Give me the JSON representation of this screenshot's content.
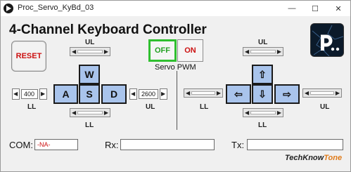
{
  "window": {
    "title": "Proc_Servo_KyBd_03",
    "minimize_glyph": "—",
    "maximize_glyph": "☐",
    "close_glyph": "✕"
  },
  "main": {
    "title": "4-Channel Keyboard Controller",
    "reset_label": "RESET",
    "logo_icon": "processing-logo-icon"
  },
  "left_pad": {
    "keys": {
      "up": "W",
      "left": "A",
      "center": "S",
      "right": "D"
    },
    "labels": {
      "top": "UL",
      "bottom": "LL",
      "left": "LL",
      "right": "UL"
    },
    "left_value": "400",
    "right_value": "2600"
  },
  "servo": {
    "off_label": "OFF",
    "on_label": "ON",
    "caption": "Servo PWM"
  },
  "right_pad": {
    "keys": {
      "up": "⇧",
      "left": "⇦",
      "center": "⇩",
      "right": "⇨"
    },
    "labels": {
      "top": "UL",
      "bottom": "LL",
      "left": "LL",
      "right": "UL"
    }
  },
  "footer": {
    "com_label": "COM:",
    "com_value": "-NA-",
    "rx_label": "Rx:",
    "rx_value": "",
    "tx_label": "Tx:",
    "tx_value": "",
    "brand_part1": "TechKnow",
    "brand_part2": "Tone"
  },
  "colors": {
    "key_fill": "#a9c4ec",
    "off_border": "#2fbf2f",
    "alert_red": "#cc1111",
    "brand_accent": "#e07b1a"
  }
}
